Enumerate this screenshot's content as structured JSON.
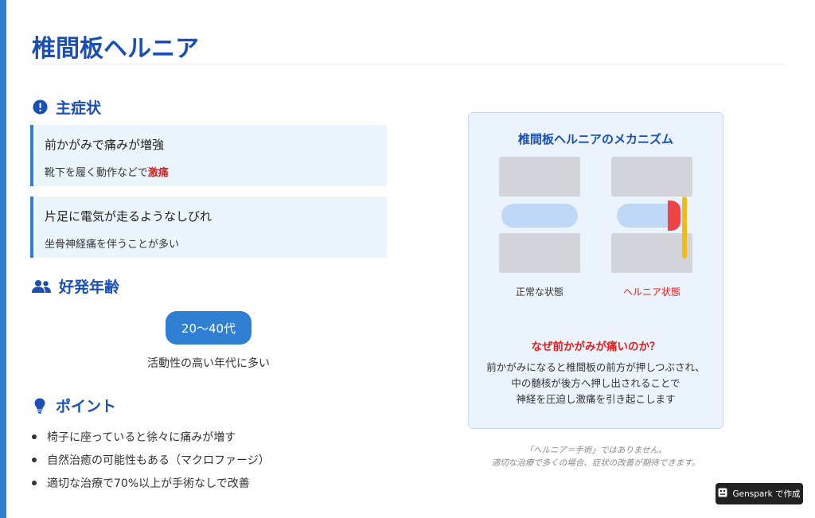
{
  "page": {
    "title": "椎間板ヘルニア",
    "accent_color": "#2f7fd3",
    "title_color": "#1a4fb5",
    "highlight_color": "#e02020"
  },
  "symptoms": {
    "heading": "主症状",
    "icon": "exclamation-circle-icon",
    "cards": [
      {
        "title": "前かがみで痛みが増強",
        "sub_pre": "靴下を履く動作などで",
        "sub_highlight": "激痛"
      },
      {
        "title": "片足に電気が走るようなしびれ",
        "sub_pre": "坐骨神経痛を伴うことが多い",
        "sub_highlight": ""
      }
    ]
  },
  "age": {
    "heading": "好発年齢",
    "icon": "users-icon",
    "range": "20〜40代",
    "note": "活動性の高い年代に多い"
  },
  "points": {
    "heading": "ポイント",
    "icon": "lightbulb-icon",
    "items": [
      "椅子に座っていると徐々に痛みが増す",
      "自然治癒の可能性もある（マクロファージ）",
      "適切な治療で70%以上が手術なしで改善"
    ]
  },
  "mechanism": {
    "title": "椎間板ヘルニアのメカニズム",
    "normal_label": "正常な状態",
    "hernia_label": "ヘルニア状態",
    "why_title": "なぜ前かがみが痛いのか？",
    "why_lines": [
      "前かがみになると椎間板の前方が押しつぶされ、",
      "中の髄核が後方へ押し出されることで",
      "神経を圧迫し激痛を引き起こします"
    ]
  },
  "footnote": {
    "lines": [
      "「ヘルニア＝手術」ではありません。",
      "適切な治療で多くの場合、症状の改善が期待できます。"
    ]
  },
  "badge": {
    "label": "Genspark で作成",
    "icon": "genspark-logo-icon"
  }
}
